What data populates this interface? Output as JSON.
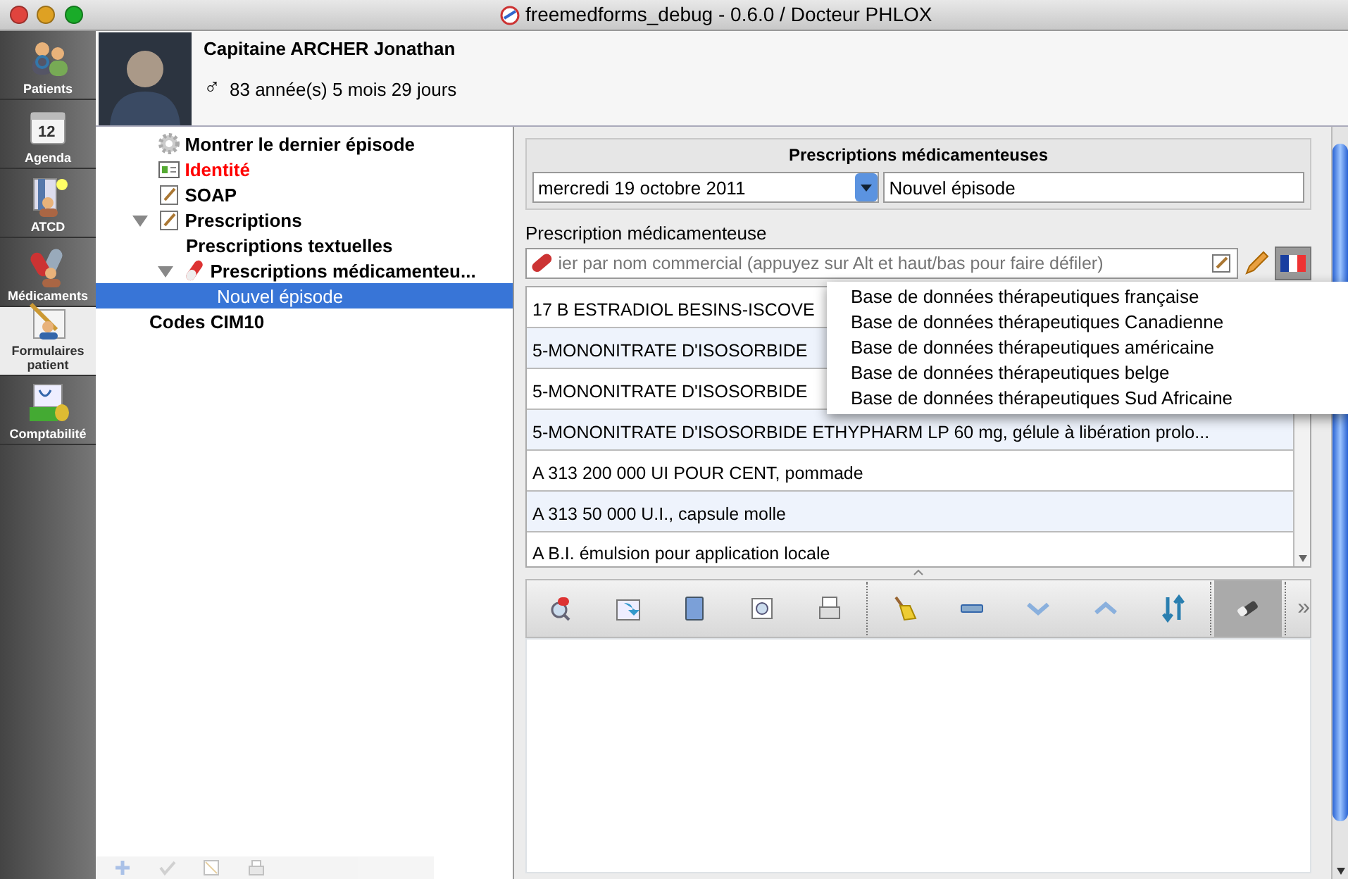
{
  "window": {
    "title": "freemedforms_debug - 0.6.0 / Docteur PHLOX"
  },
  "sidebar": {
    "items": [
      {
        "label": "Patients",
        "selected": false
      },
      {
        "label": "Agenda",
        "selected": false,
        "icon_label": "12"
      },
      {
        "label": "ATCD",
        "selected": false
      },
      {
        "label": "Médicaments",
        "selected": false
      },
      {
        "label": "Formulaires patient",
        "selected": true
      },
      {
        "label": "Comptabilité",
        "selected": false
      }
    ]
  },
  "patient": {
    "name": "Capitaine ARCHER Jonathan",
    "gender_symbol": "♂",
    "age": "83 année(s) 5 mois 29 jours"
  },
  "tree": {
    "items": [
      {
        "label": "Montrer le dernier épisode",
        "kind": "gear",
        "selected": false
      },
      {
        "label": "Identité",
        "kind": "card",
        "selected": false,
        "color": "#ff0000"
      },
      {
        "label": "SOAP",
        "kind": "note",
        "selected": false
      },
      {
        "label": "Prescriptions",
        "kind": "note",
        "selected": false,
        "expanded": true,
        "children": [
          {
            "label": "Prescriptions textuelles",
            "kind": "plain",
            "selected": false
          },
          {
            "label": "Prescriptions médicamenteu...",
            "kind": "pill",
            "selected": false,
            "expanded": true,
            "children": [
              {
                "label": "Nouvel épisode",
                "kind": "plain",
                "selected": true
              }
            ]
          }
        ]
      },
      {
        "label": "Codes CIM10",
        "kind": "heading",
        "selected": false
      }
    ]
  },
  "prescription": {
    "group_title": "Prescriptions médicamenteuses",
    "date": "mercredi 19 octobre 2011",
    "episode": "Nouvel épisode",
    "label": "Prescription médicamenteuse",
    "search_placeholder": "ier par nom commercial (appuyez sur Alt et haut/bas pour faire défiler)",
    "flag_button": {
      "selected": true
    },
    "database_menu": {
      "items": [
        "Base de données thérapeutiques française",
        "Base de données thérapeutiques Canadienne",
        "Base de données thérapeutiques américaine",
        "Base de données thérapeutiques belge",
        "Base de données thérapeutiques Sud Africaine"
      ]
    },
    "drugs": [
      "17 B ESTRADIOL BESINS-ISCOVE",
      "5-MONONITRATE D'ISOSORBIDE",
      "5-MONONITRATE D'ISOSORBIDE",
      "5-MONONITRATE D'ISOSORBIDE ETHYPHARM LP 60 mg, gélule à libération prolo...",
      "A 313 200 000 UI POUR CENT, pommade",
      "A 313 50 000 U.I., capsule molle",
      "A B.I. émulsion pour application locale"
    ],
    "toolbar": [
      {
        "selected": false
      },
      {
        "selected": false
      },
      {
        "selected": false
      },
      {
        "selected": false
      },
      {
        "selected": false
      },
      {
        "selected": false
      },
      {
        "selected": false
      },
      {
        "selected": false
      },
      {
        "selected": false
      },
      {
        "selected": false
      },
      {
        "selected": true
      }
    ],
    "toolbar_more": "»"
  }
}
